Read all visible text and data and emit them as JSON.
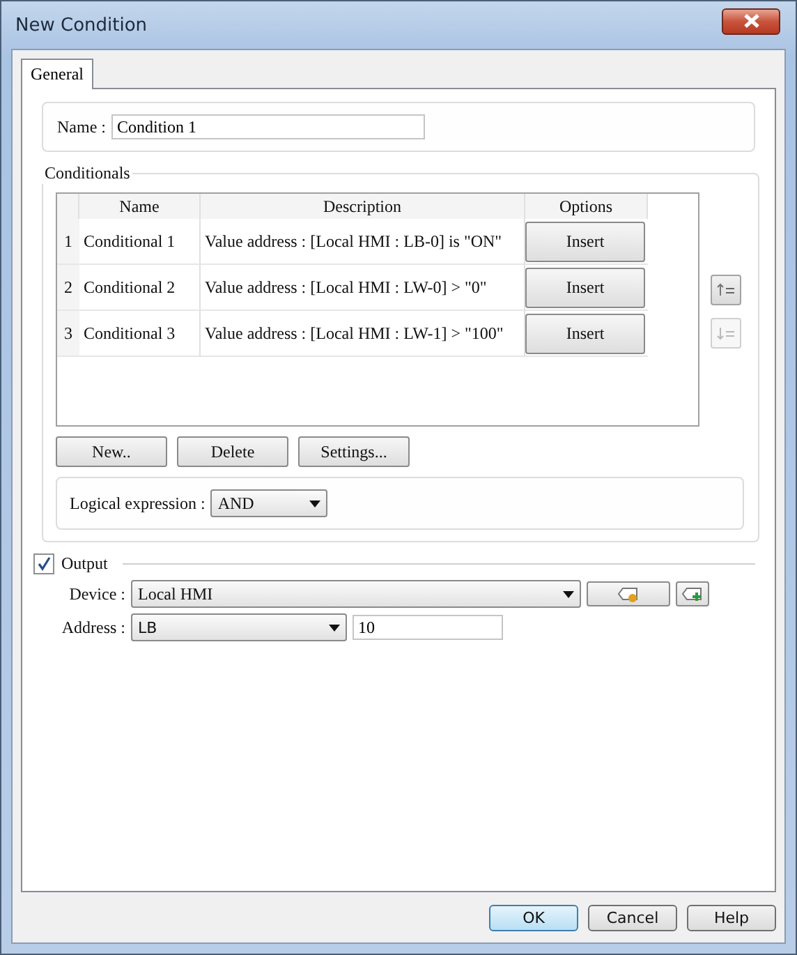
{
  "window": {
    "title": "New Condition"
  },
  "tabs": [
    {
      "label": "General",
      "selected": true
    }
  ],
  "name_field": {
    "label": "Name :",
    "value": "Condition 1"
  },
  "conditionals": {
    "title": "Conditionals",
    "columns": [
      "Name",
      "Description",
      "Options"
    ],
    "rows": [
      {
        "index": "1",
        "name": "Conditional 1",
        "description": "Value address : [Local HMI : LB-0] is \"ON\"",
        "option": "Insert"
      },
      {
        "index": "2",
        "name": "Conditional 2",
        "description": "Value address : [Local HMI : LW-0] > \"0\"",
        "option": "Insert"
      },
      {
        "index": "3",
        "name": "Conditional 3",
        "description": "Value address : [Local HMI : LW-1] > \"100\"",
        "option": "Insert"
      }
    ],
    "side_buttons": [
      {
        "disabled": false
      },
      {
        "disabled": true
      }
    ],
    "buttons": [
      "New..",
      "Delete",
      "Settings..."
    ],
    "logical_expression": {
      "label": "Logical expression :",
      "value": "AND"
    }
  },
  "output": {
    "label": "Output",
    "checked": true,
    "device": {
      "label": "Device :",
      "value": "Local HMI"
    },
    "address": {
      "label": "Address :",
      "type": "LB",
      "value": "10"
    }
  },
  "footer_buttons": [
    {
      "label": "OK",
      "selected": true
    },
    {
      "label": "Cancel",
      "selected": false
    },
    {
      "label": "Help",
      "selected": false
    }
  ]
}
